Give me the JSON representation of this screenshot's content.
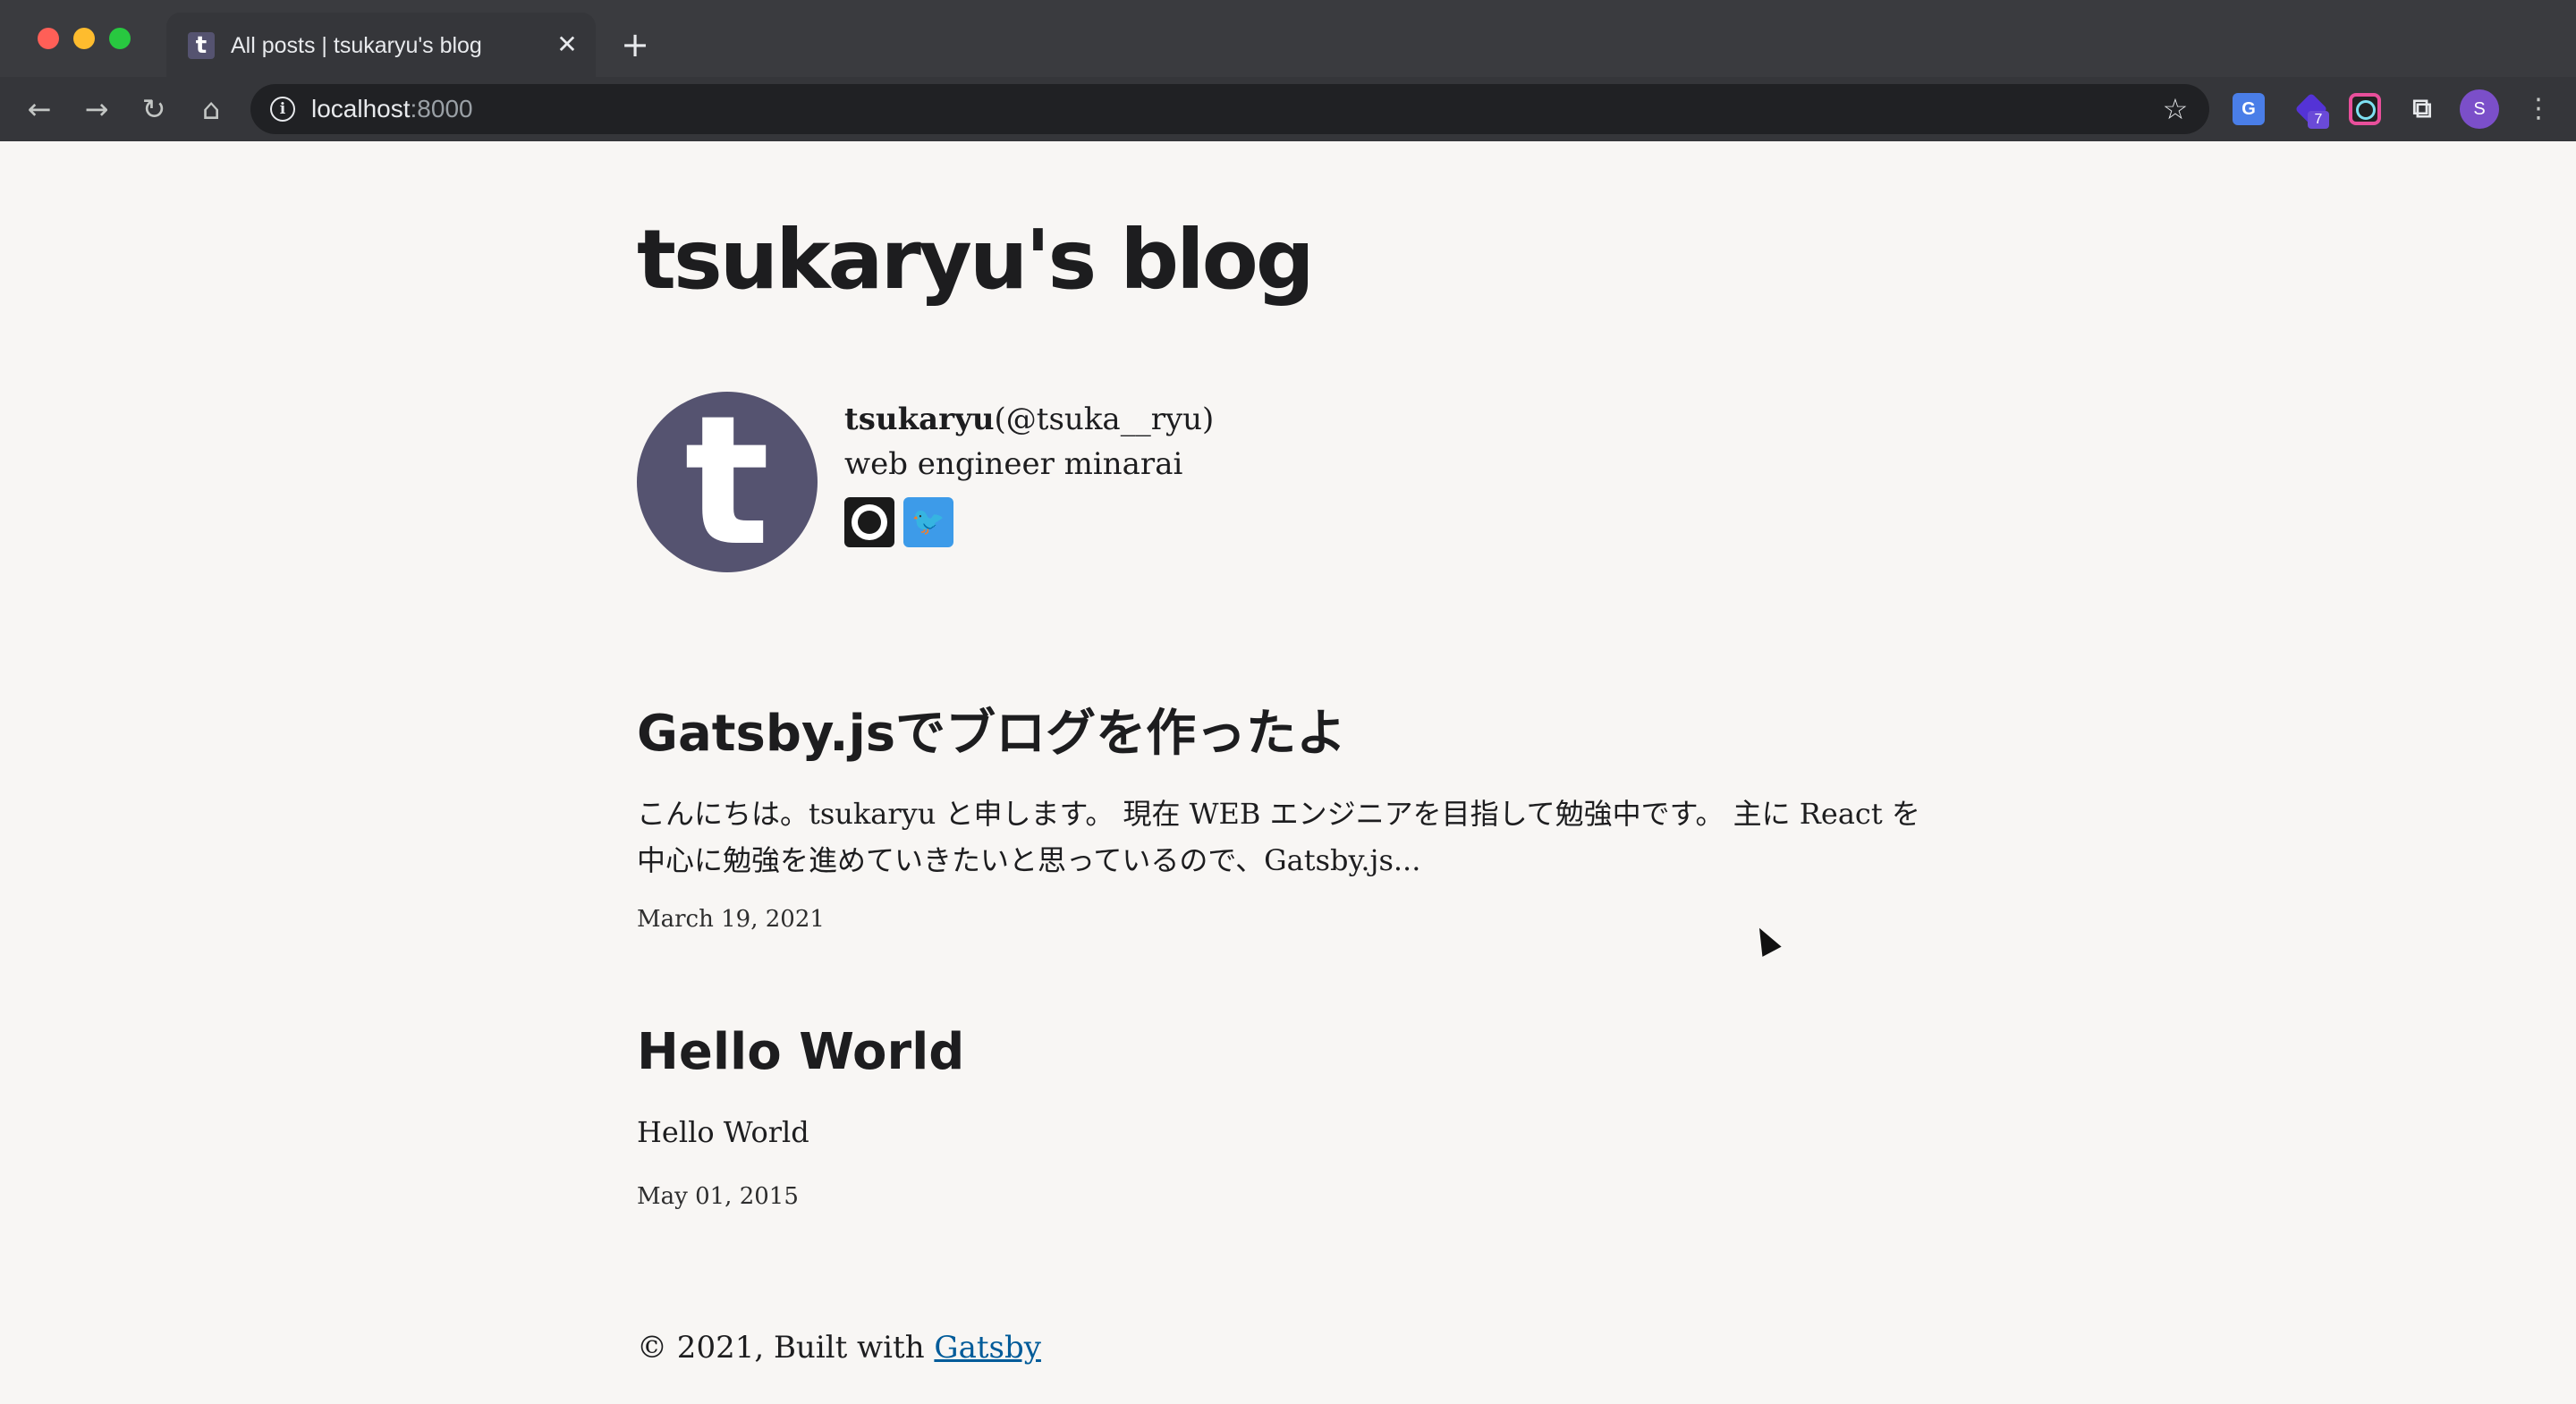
{
  "browser": {
    "tab": {
      "title": "All posts | tsukaryu's blog",
      "favicon_letter": "t",
      "close": "✕"
    },
    "new_tab": "+",
    "nav": {
      "back": "←",
      "forward": "→",
      "reload": "↻",
      "home": "⌂"
    },
    "address": {
      "host": "localhost",
      "port": ":8000",
      "info_icon": "i",
      "bookmark": "☆"
    },
    "extensions": {
      "translate": "G",
      "badge": "7",
      "puzzle": "⧉"
    },
    "profile_initial": "S",
    "menu": "⋮"
  },
  "blog": {
    "title": "tsukaryu's blog",
    "bio": {
      "avatar_letter": "t",
      "author": "tsukaryu",
      "handle": "(@tsuka__ryu)",
      "description": "web engineer minarai",
      "twitter_glyph": "🐦"
    },
    "posts": [
      {
        "title": "Gatsby.jsでブログを作ったよ",
        "excerpt": "こんにちは。tsukaryu と申します。 現在 WEB エンジニアを目指して勉強中です。 主に React を中心に勉強を進めていきたいと思っているので、Gatsby.js...",
        "date": "March 19, 2021"
      },
      {
        "title": "Hello World",
        "excerpt": "Hello World",
        "date": "May 01, 2015"
      }
    ],
    "footer": {
      "prefix": "© 2021, Built with ",
      "link": "Gatsby"
    }
  }
}
